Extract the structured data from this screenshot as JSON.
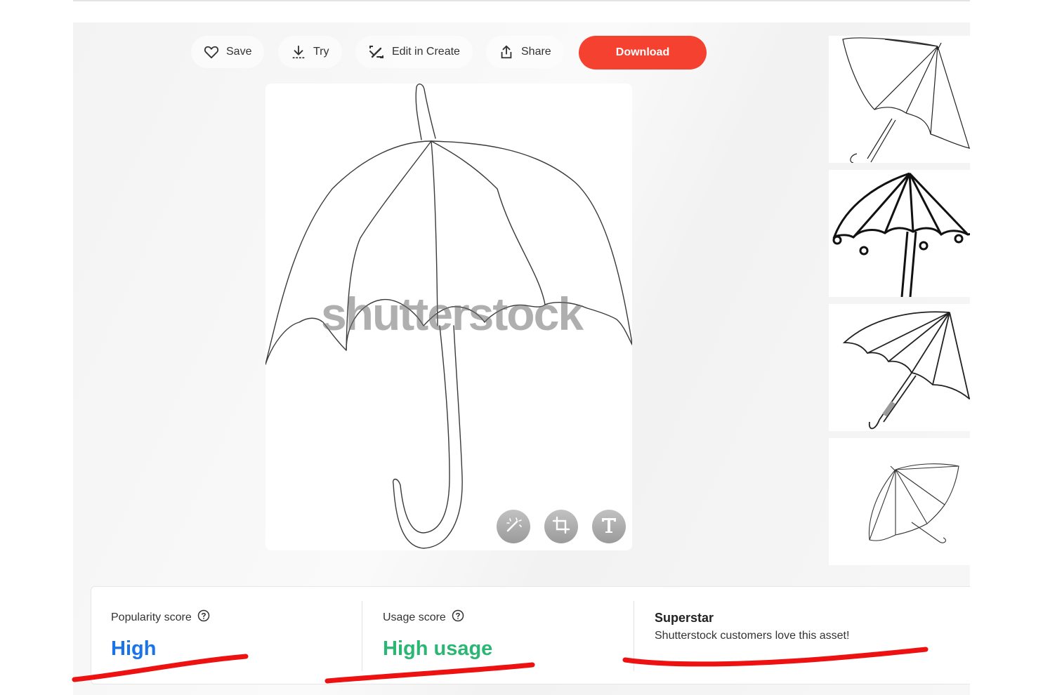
{
  "toolbar": {
    "save_label": "Save",
    "try_label": "Try",
    "edit_label": "Edit in Create",
    "share_label": "Share",
    "download_label": "Download"
  },
  "preview": {
    "watermark": "shutterstock"
  },
  "stats": {
    "popularity": {
      "label": "Popularity score",
      "value": "High",
      "color": "#1a73e8"
    },
    "usage": {
      "label": "Usage score",
      "value": "High usage",
      "color": "#2bb673"
    },
    "superstar": {
      "title": "Superstar",
      "description": "Shutterstock customers love this asset!"
    }
  },
  "colors": {
    "download": "#f5412f",
    "annotation": "#ee1111"
  },
  "icons": {
    "save": "heart-icon",
    "try": "download-arrow-icon",
    "edit": "edit-create-icon",
    "share": "share-icon",
    "help": "help-circle-icon",
    "tools": [
      "magic-wand-icon",
      "crop-icon",
      "text-icon"
    ]
  }
}
